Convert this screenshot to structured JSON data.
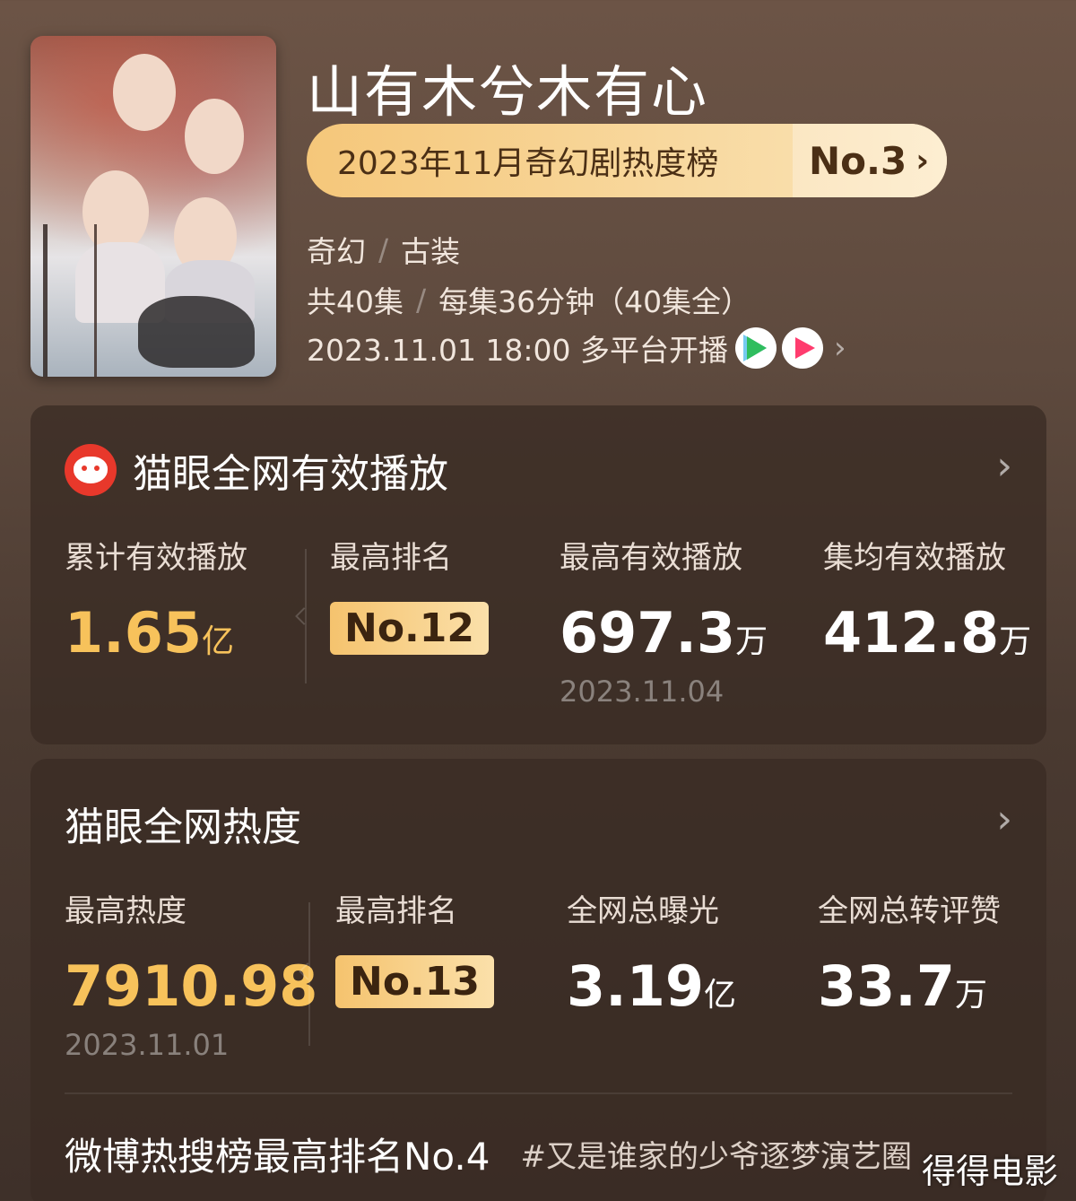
{
  "show": {
    "title": "山有木兮木有心",
    "rank_label": "2023年11月奇幻剧热度榜",
    "rank_no": "No.3",
    "genre_1": "奇幻",
    "genre_2": "古装",
    "episodes": "共40集",
    "episode_length": "每集36分钟（40集全）",
    "premiere": "2023.11.01 18:00 多平台开播",
    "platform_icons": [
      "tencent-video-icon",
      "youku-icon"
    ]
  },
  "card_play": {
    "title": "猫眼全网有效播放",
    "stats": [
      {
        "label": "累计有效播放",
        "value": "1.65",
        "unit": "亿"
      },
      {
        "label": "最高排名",
        "rank": "No.12"
      },
      {
        "label": "最高有效播放",
        "value": "697.3",
        "unit": "万",
        "date": "2023.11.04"
      },
      {
        "label": "集均有效播放",
        "value": "412.8",
        "unit": "万"
      }
    ]
  },
  "card_heat": {
    "title": "猫眼全网热度",
    "stats": [
      {
        "label": "最高热度",
        "value": "7910.98",
        "date": "2023.11.01"
      },
      {
        "label": "最高排名",
        "rank": "No.13"
      },
      {
        "label": "全网总曝光",
        "value": "3.19",
        "unit": "亿"
      },
      {
        "label": "全网总转评赞",
        "value": "33.7",
        "unit": "万"
      }
    ],
    "weibo_rank": "微博热搜榜最高排名No.4",
    "weibo_tag": "#又是谁家的少爷逐梦演艺圈"
  },
  "watermark": "得得电影",
  "colors": {
    "accent_gold": "#f7c25b",
    "badge_gold": "#f5c36e",
    "maoyan_red": "#e8382b"
  }
}
